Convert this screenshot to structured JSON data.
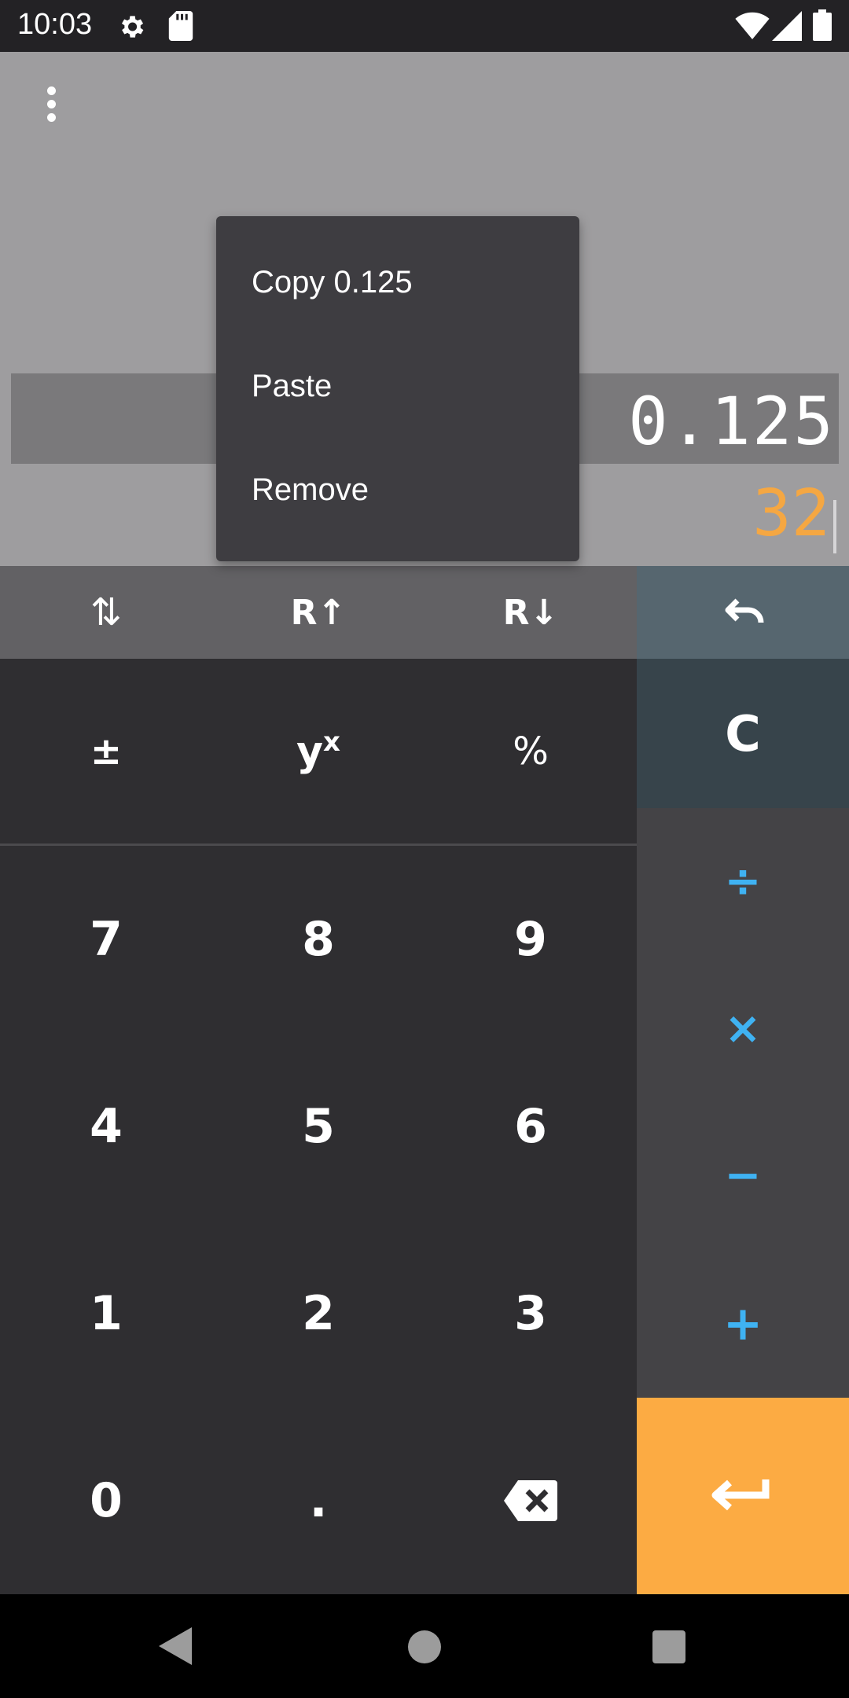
{
  "status_bar": {
    "time": "10:03"
  },
  "display": {
    "stack_value": "0.125",
    "input_value": "32"
  },
  "context_menu": {
    "items": [
      "Copy 0.125",
      "Paste",
      "Remove"
    ]
  },
  "keys": {
    "swap": "⇅",
    "roll_up": "R↑",
    "roll_down": "R↓",
    "plus_minus": "±",
    "power_base": "y",
    "power_exp": "x",
    "percent": "%",
    "clear": "C",
    "divide": "÷",
    "multiply": "×",
    "subtract": "−",
    "add": "+",
    "digits": [
      "7",
      "8",
      "9",
      "4",
      "5",
      "6",
      "1",
      "2",
      "3",
      "0"
    ],
    "decimal": "."
  },
  "colors": {
    "accent_orange": "#fcab43",
    "operator_blue": "#3fb2f2",
    "input_text": "#f5a742"
  }
}
